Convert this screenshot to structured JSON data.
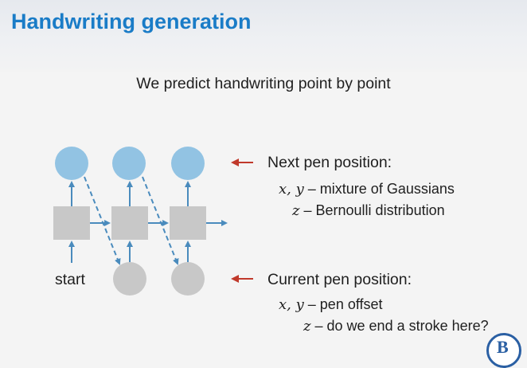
{
  "slide": {
    "title": "Handwriting generation",
    "subtitle": "We predict handwriting point by point"
  },
  "diagram": {
    "start_label": "start",
    "columns": 3,
    "output_color": "#92c3e3",
    "hidden_color": "#c8c8c8",
    "input_color": "#c8c8c8",
    "edge_color": "#4a8bbd",
    "pointer_arrow_color": "#c0392b"
  },
  "annotations": {
    "next": {
      "heading": "Next pen position:",
      "xy_math": "x, y",
      "xy_text": "– mixture of Gaussians",
      "z_math": "z",
      "z_text": "– Bernoulli distribution"
    },
    "current": {
      "heading": "Current pen position:",
      "xy_math": "x, y",
      "xy_text": "– pen offset",
      "z_math": "z",
      "z_text": "– do we end a stroke here?"
    }
  },
  "logo": {
    "letter": "B"
  }
}
